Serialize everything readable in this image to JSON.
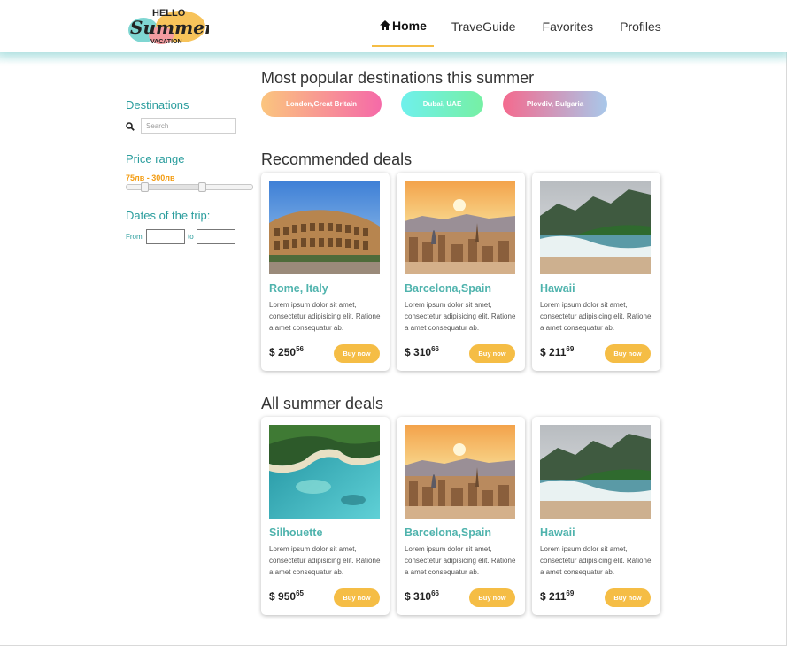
{
  "header": {
    "logo_line1": "HELLO",
    "logo_line2": "Summer",
    "logo_line3": "VACATION",
    "nav": [
      {
        "label": "Home",
        "icon": "home-icon",
        "active": true
      },
      {
        "label": "TraveGuide"
      },
      {
        "label": "Favorites"
      },
      {
        "label": "Profiles"
      }
    ]
  },
  "sidebar": {
    "destinations_heading": "Destinations",
    "search_placeholder": "Search",
    "search_icon": "search-icon",
    "price_heading": "Price range",
    "price_value": "75лв - 300лв",
    "dates_heading": "Dates of the trip:",
    "from_label": "From",
    "to_label": "to"
  },
  "main": {
    "popular_title": "Most popular destinations this summer",
    "popular": [
      {
        "label": "London,Great Britain",
        "gradient": [
          "#fbc57e",
          "#f56aa8"
        ]
      },
      {
        "label": "Dubai, UAE",
        "gradient": [
          "#6ff0ec",
          "#76f0a4"
        ]
      },
      {
        "label": "Plovdiv, Bulgaria",
        "gradient": [
          "#f46a8e",
          "#a8c8ea"
        ]
      }
    ],
    "recommended_title": "Recommended deals",
    "all_title": "All summer deals",
    "buy_label": "Buy now",
    "desc": "Lorem ipsum dolor sit amet, consectetur adipisicing elit. Ratione a amet consequatur ab.",
    "currency": "$",
    "recommended": [
      {
        "title": "Rome, Italy",
        "price": "250",
        "cents": "56",
        "image": "colosseum"
      },
      {
        "title": "Barcelona,Spain",
        "price": "310",
        "cents": "66",
        "image": "city-sunset"
      },
      {
        "title": "Hawaii",
        "price": "211",
        "cents": "69",
        "image": "coast"
      }
    ],
    "all": [
      {
        "title": "Silhouette",
        "price": "950",
        "cents": "65",
        "image": "island-aerial"
      },
      {
        "title": "Barcelona,Spain",
        "price": "310",
        "cents": "66",
        "image": "city-sunset"
      },
      {
        "title": "Hawaii",
        "price": "211",
        "cents": "69",
        "image": "coast"
      }
    ]
  },
  "colors": {
    "accent": "#f5bd45",
    "teal": "#2a9d9d",
    "card_title": "#4fb3ad",
    "price_text": "#f39c12"
  }
}
